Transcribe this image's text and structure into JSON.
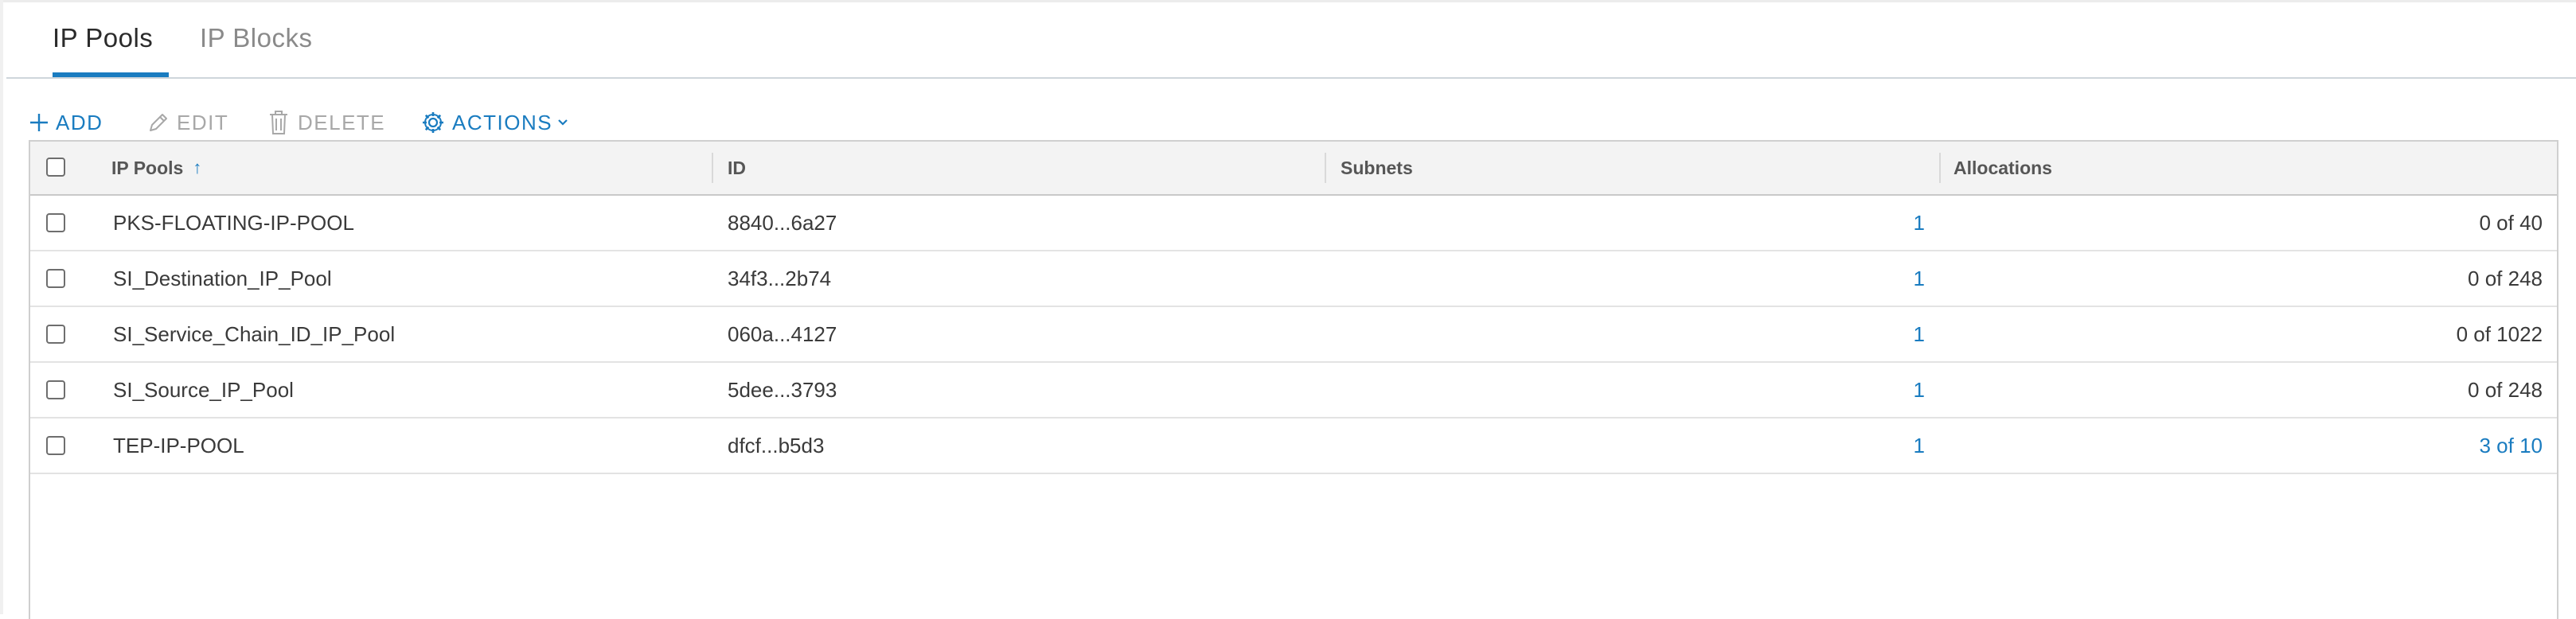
{
  "tabs": [
    {
      "label": "IP Pools",
      "active": true
    },
    {
      "label": "IP Blocks",
      "active": false
    }
  ],
  "toolbar": {
    "add": {
      "label": "ADD",
      "icon": "plus-icon"
    },
    "edit": {
      "label": "EDIT",
      "icon": "pencil-icon"
    },
    "delete": {
      "label": "DELETE",
      "icon": "trash-icon"
    },
    "actions": {
      "label": "ACTIONS",
      "icon": "gear-icon"
    }
  },
  "table": {
    "columns": [
      "IP Pools",
      "ID",
      "Subnets",
      "Allocations"
    ],
    "sort_icon": "arrow-up-icon",
    "rows": [
      {
        "name": "PKS-FLOATING-IP-POOL",
        "id": "8840...6a27",
        "subnets": "1",
        "allocations": "0 of 40",
        "allocations_link": false
      },
      {
        "name": "SI_Destination_IP_Pool",
        "id": "34f3...2b74",
        "subnets": "1",
        "allocations": "0 of 248",
        "allocations_link": false
      },
      {
        "name": "SI_Service_Chain_ID_IP_Pool",
        "id": "060a...4127",
        "subnets": "1",
        "allocations": "0 of 1022",
        "allocations_link": false
      },
      {
        "name": "SI_Source_IP_Pool",
        "id": "5dee...3793",
        "subnets": "1",
        "allocations": "0 of 248",
        "allocations_link": false
      },
      {
        "name": "TEP-IP-POOL",
        "id": "dfcf...b5d3",
        "subnets": "1",
        "allocations": "3 of 10",
        "allocations_link": true
      }
    ]
  },
  "colors": {
    "accent": "#1a7cc0",
    "disabled": "#a8a8a8",
    "header_bg": "#f3f3f3"
  }
}
